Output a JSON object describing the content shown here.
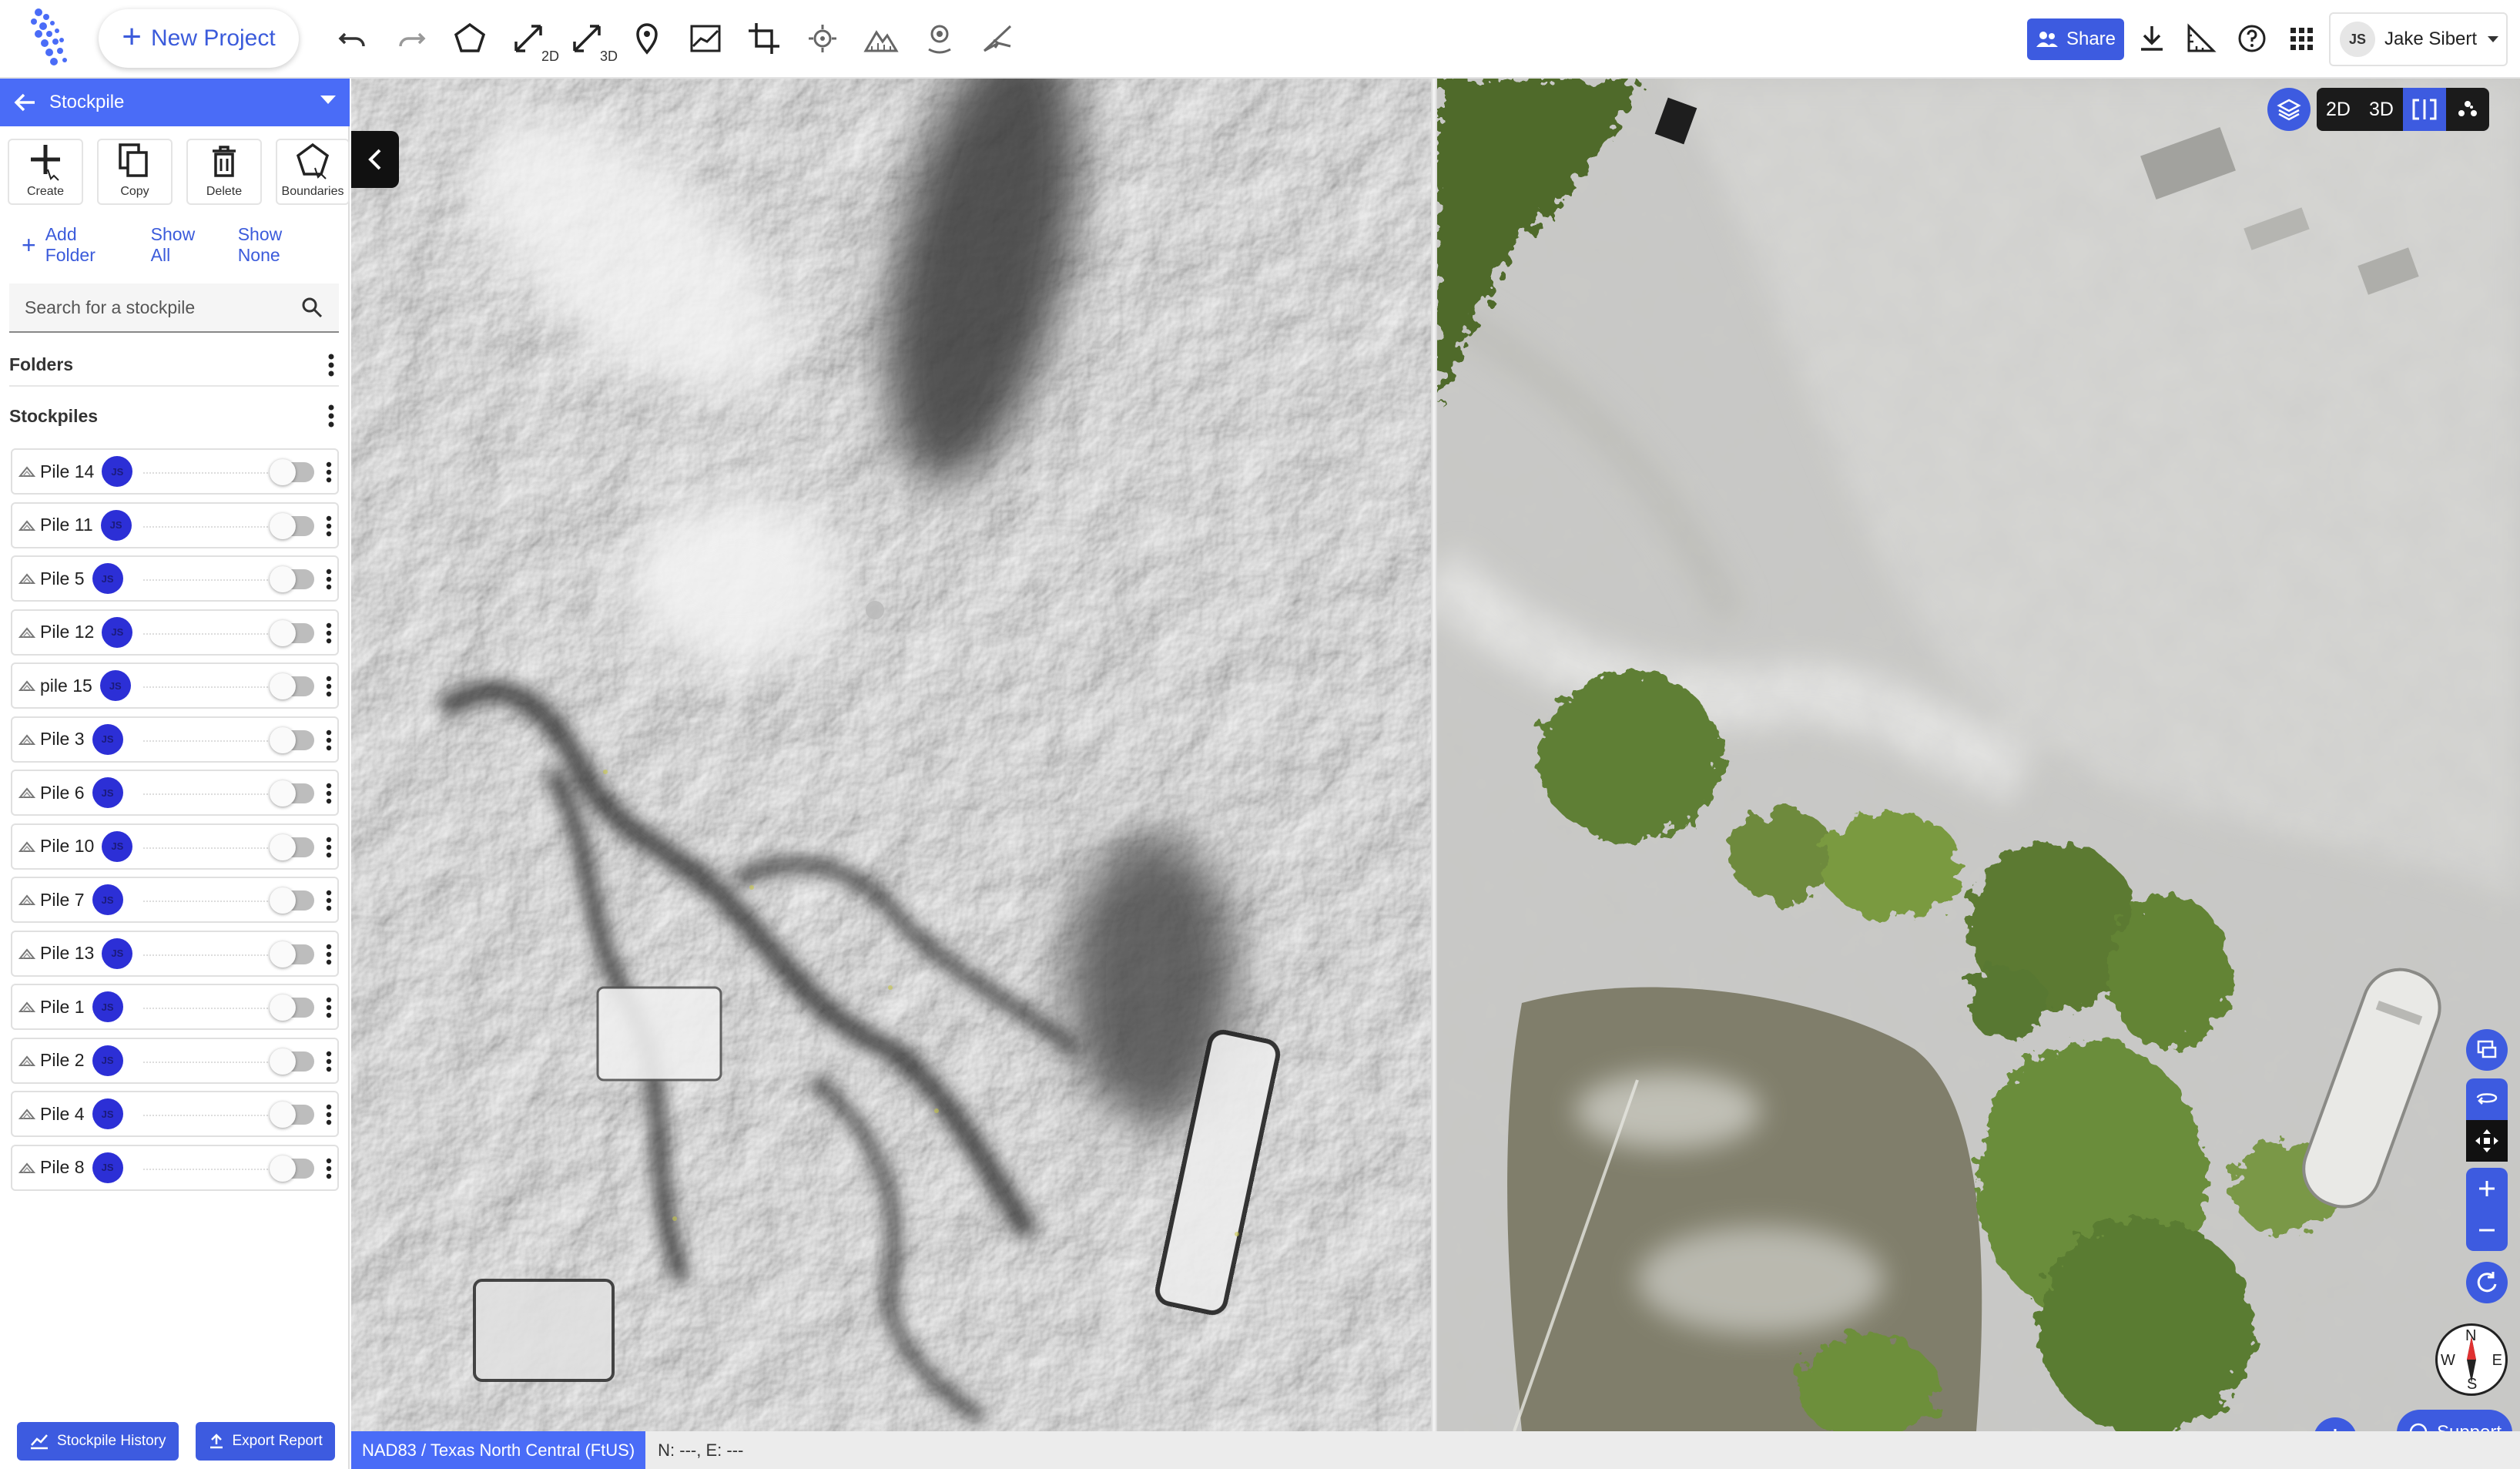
{
  "topbar": {
    "new_project_label": "New Project",
    "tools": [
      "undo-icon",
      "redo-icon",
      "polygon-icon",
      "measure-2d-icon",
      "measure-3d-icon",
      "marker-icon",
      "elevation-profile-icon",
      "crop-icon",
      "target-icon",
      "terrain-icon",
      "pin-icon",
      "slope-icon"
    ],
    "measure_2d_sub": "2D",
    "measure_3d_sub": "3D",
    "share_label": "Share",
    "user_initials": "JS",
    "user_name": "Jake Sibert"
  },
  "sidebar": {
    "title": "Stockpile",
    "tools": [
      {
        "label": "Create",
        "icon": "create-icon"
      },
      {
        "label": "Copy",
        "icon": "copy-icon"
      },
      {
        "label": "Delete",
        "icon": "delete-icon"
      },
      {
        "label": "Boundaries",
        "icon": "boundaries-icon"
      }
    ],
    "add_folder": "Add Folder",
    "show_all": "Show All",
    "show_none": "Show None",
    "search_placeholder": "Search for a stockpile",
    "folders_label": "Folders",
    "stockpiles_label": "Stockpiles",
    "badge_initials": "JS",
    "piles": [
      {
        "name": "Pile 14",
        "visible": false
      },
      {
        "name": "Pile 11",
        "visible": false
      },
      {
        "name": "Pile 5",
        "visible": false
      },
      {
        "name": "Pile 12",
        "visible": false
      },
      {
        "name": "pile 15",
        "visible": false
      },
      {
        "name": "Pile 3",
        "visible": false
      },
      {
        "name": "Pile 6",
        "visible": false
      },
      {
        "name": "Pile 10",
        "visible": false
      },
      {
        "name": "Pile 7",
        "visible": false
      },
      {
        "name": "Pile 13",
        "visible": false
      },
      {
        "name": "Pile 1",
        "visible": false
      },
      {
        "name": "Pile 2",
        "visible": false
      },
      {
        "name": "Pile 4",
        "visible": false
      },
      {
        "name": "Pile 8",
        "visible": false
      }
    ],
    "history_label": "Stockpile History",
    "export_label": "Export Report"
  },
  "map": {
    "view_2d": "2D",
    "view_3d": "3D",
    "crs": "NAD83 / Texas North Central (FtUS)",
    "coords": "N: ---, E: ---",
    "compass": {
      "n": "N",
      "e": "E",
      "s": "S",
      "w": "W"
    },
    "support_label": "Support"
  },
  "colors": {
    "accent": "#3d5be0",
    "header": "#4a6cf7",
    "badge": "#2c2fd6"
  }
}
